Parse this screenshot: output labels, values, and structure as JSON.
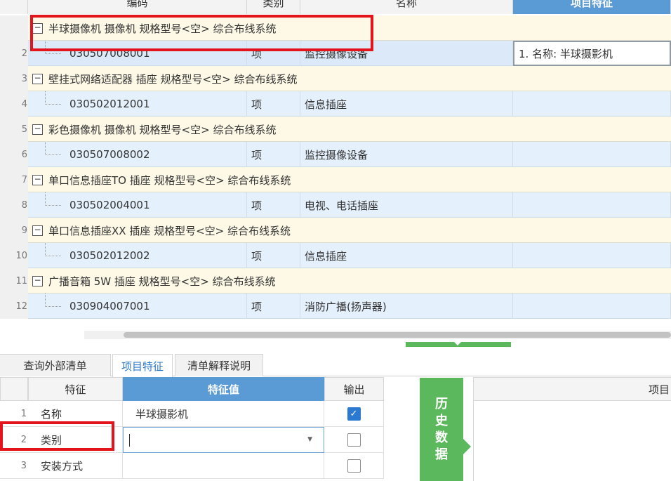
{
  "columns": {
    "code": "编码",
    "type": "类别",
    "name": "名称",
    "feature": "项目特征"
  },
  "rows": [
    {
      "kind": "group",
      "num": "",
      "text": "半球摄像机 摄像机 规格型号<空> 综合布线系统"
    },
    {
      "kind": "item",
      "num": "2",
      "code": "030507008001",
      "type": "项",
      "name": "监控摄像设备",
      "feature": "1. 名称: 半球摄影机"
    },
    {
      "kind": "group",
      "num": "3",
      "text": "壁挂式网络适配器 插座 规格型号<空> 综合布线系统"
    },
    {
      "kind": "item",
      "num": "4",
      "code": "030502012001",
      "type": "项",
      "name": "信息插座",
      "feature": ""
    },
    {
      "kind": "group",
      "num": "5",
      "text": "彩色摄像机 摄像机 规格型号<空> 综合布线系统"
    },
    {
      "kind": "item",
      "num": "6",
      "code": "030507008002",
      "type": "项",
      "name": "监控摄像设备",
      "feature": ""
    },
    {
      "kind": "group",
      "num": "7",
      "text": "单口信息插座TO 插座 规格型号<空> 综合布线系统"
    },
    {
      "kind": "item",
      "num": "8",
      "code": "030502004001",
      "type": "项",
      "name": "电视、电话插座",
      "feature": ""
    },
    {
      "kind": "group",
      "num": "9",
      "text": "单口信息插座XX 插座 规格型号<空> 综合布线系统"
    },
    {
      "kind": "item",
      "num": "10",
      "code": "030502012002",
      "type": "项",
      "name": "信息插座",
      "feature": ""
    },
    {
      "kind": "group",
      "num": "11",
      "text": "广播音箱  5W 插座 规格型号<空> 综合布线系统"
    },
    {
      "kind": "item",
      "num": "12",
      "code": "030904007001",
      "type": "项",
      "name": "消防广播(扬声器)",
      "feature": ""
    }
  ],
  "expander_symbol": "−",
  "tabs": [
    "查询外部清单",
    "项目特征",
    "清单解释说明"
  ],
  "active_tab": "项目特征",
  "feature_grid": {
    "headers": {
      "feature": "特征",
      "value": "特征值",
      "output": "输出"
    },
    "rows": [
      {
        "num": "1",
        "feature": "名称",
        "value": "半球摄影机",
        "output": true
      },
      {
        "num": "2",
        "feature": "类别",
        "value": "",
        "output": false
      },
      {
        "num": "3",
        "feature": "安装方式",
        "value": "",
        "output": false
      }
    ]
  },
  "history_button": [
    "历",
    "史",
    "数",
    "据"
  ],
  "right_panel_header": "项目",
  "accent_color": "#5b9bd5",
  "green_color": "#5cb85c",
  "highlight_color": "#e3141b"
}
